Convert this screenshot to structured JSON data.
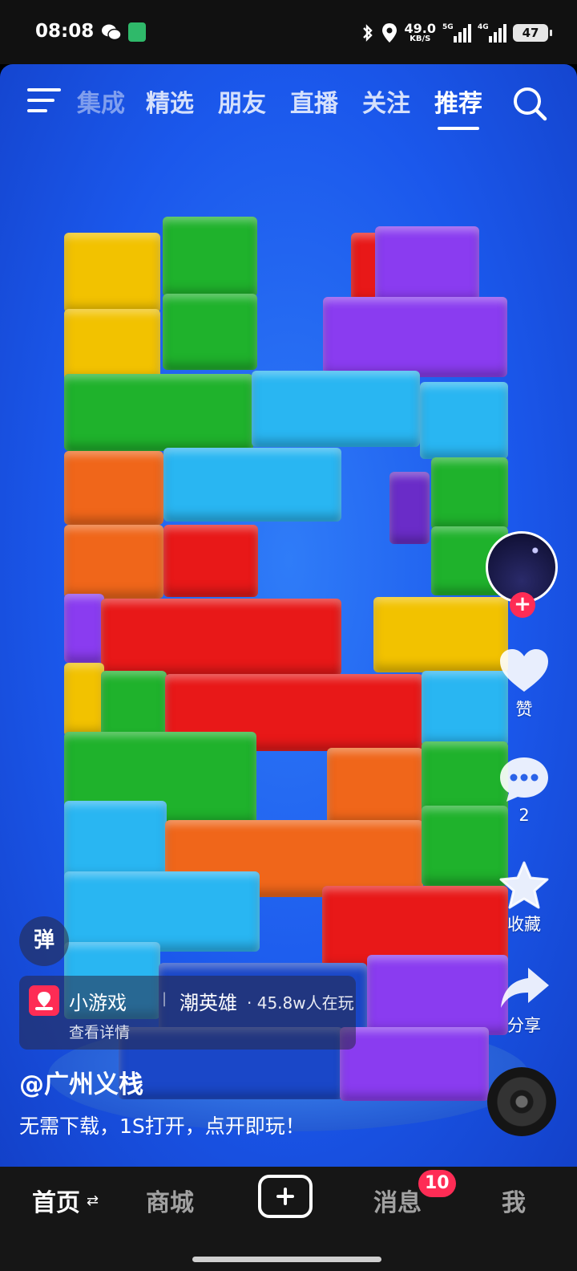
{
  "status_bar": {
    "time": "08:08",
    "net_speed_value": "49.0",
    "net_speed_unit": "KB/S",
    "signal1_label": "5G",
    "signal2_label": "4G",
    "battery": "47"
  },
  "top_nav": {
    "tabs": [
      "集成",
      "精选",
      "朋友",
      "直播",
      "关注",
      "推荐"
    ],
    "active_tab": "推荐"
  },
  "actions": {
    "like_label": "赞",
    "comment_count": "2",
    "favorite_label": "收藏",
    "share_label": "分享"
  },
  "overlay": {
    "danmu_label": "弹",
    "game_tag": "小游戏",
    "game_separator": "|",
    "game_name": "潮英雄",
    "game_players": "· 45.8w人在玩",
    "game_detail": "查看详情",
    "author": "@广州义栈",
    "caption": "无需下载，1S打开，点开即玩！"
  },
  "bottom_nav": {
    "home": "首页",
    "home_swap": "⇄",
    "mall": "商城",
    "messages": "消息",
    "messages_badge": "10",
    "me": "我"
  },
  "colors": {
    "accent": "#fe2c55",
    "video_bg": "#1b58ec",
    "block_colors": [
      "#f2c200",
      "#1fb22c",
      "#e81818",
      "#8a3cf0",
      "#29b6f2",
      "#f0661a"
    ]
  }
}
